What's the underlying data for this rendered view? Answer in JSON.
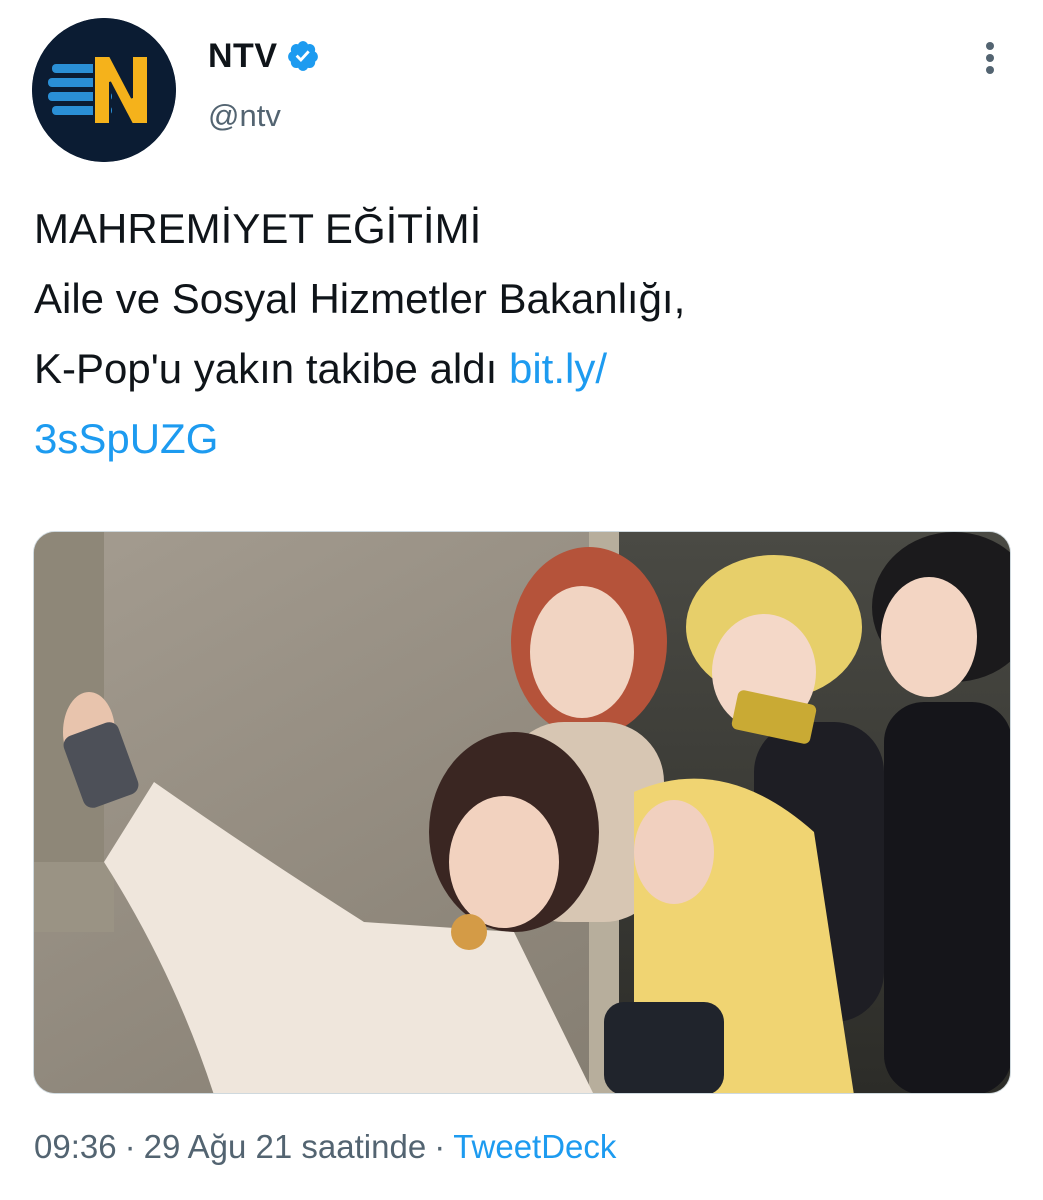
{
  "author": {
    "display_name": "NTV",
    "handle": "@ntv",
    "verified": true,
    "avatar_icon": "ntv-logo",
    "verified_icon": "verified-badge-icon",
    "more_icon": "more-vertical-icon"
  },
  "tweet": {
    "lines": [
      "MAHREMİYET EĞİTİMİ",
      "Aile ve Sosyal Hizmetler Bakanlığı,",
      "K-Pop'u yakın takibe aldı "
    ],
    "link_part1": "bit.ly/",
    "link_part2": "3sSpUZG"
  },
  "media": {
    "type": "photo"
  },
  "footer": {
    "time": "09:36",
    "date": "29 Ağu 21 saatinde",
    "dot": "·",
    "source": "TweetDeck"
  },
  "colors": {
    "link": "#1d9bf0",
    "secondary_text": "#536471",
    "primary_text": "#0f1419",
    "verified": "#1d9bf0",
    "logo_bg": "#0b1c33",
    "logo_yellow": "#f5b21b",
    "logo_blue": "#2a8fd6"
  }
}
